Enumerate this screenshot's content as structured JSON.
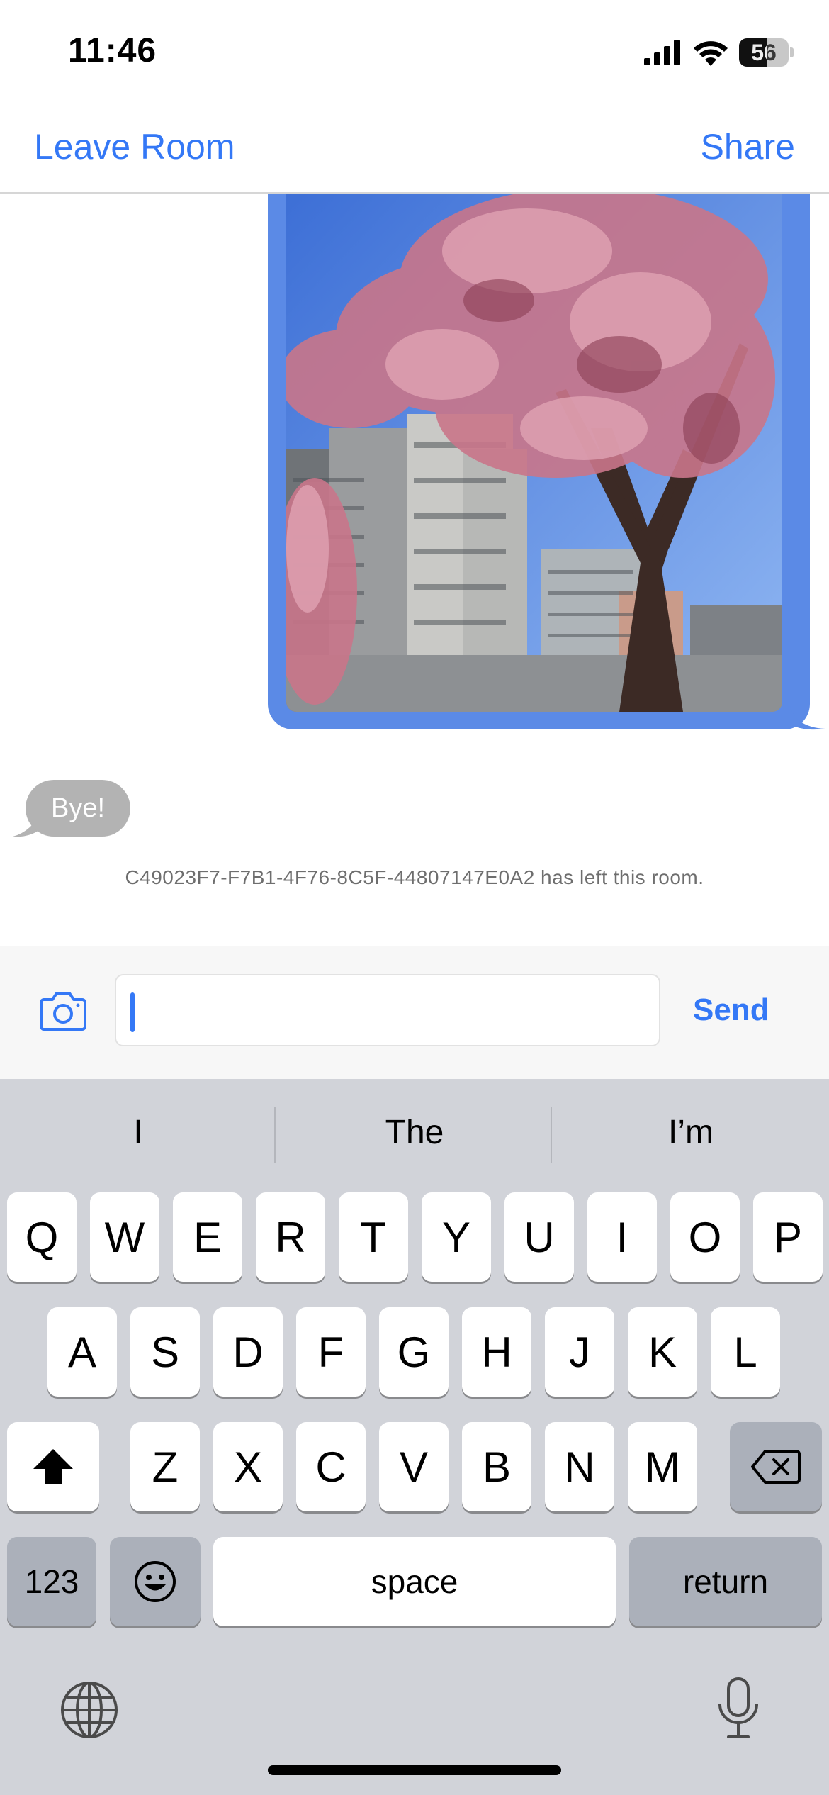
{
  "status_bar": {
    "time": "11:46",
    "battery_level": "56"
  },
  "nav": {
    "leave_label": "Leave Room",
    "share_label": "Share"
  },
  "messages": {
    "bye_text": "Bye!",
    "system_note": "C49023F7-F7B1-4F76-8C5F-44807147E0A2 has left this room."
  },
  "input": {
    "value": "",
    "send_label": "Send"
  },
  "keyboard": {
    "suggestions": [
      "I",
      "The",
      "I’m"
    ],
    "row1": [
      "Q",
      "W",
      "E",
      "R",
      "T",
      "Y",
      "U",
      "I",
      "O",
      "P"
    ],
    "row2": [
      "A",
      "S",
      "D",
      "F",
      "G",
      "H",
      "J",
      "K",
      "L"
    ],
    "row3": [
      "Z",
      "X",
      "C",
      "V",
      "B",
      "N",
      "M"
    ],
    "numbers_label": "123",
    "space_label": "space",
    "return_label": "return"
  },
  "colors": {
    "accent": "#3478f6",
    "outgoing_bubble": "#5b8ae6",
    "incoming_bubble": "#b3b3b3"
  }
}
